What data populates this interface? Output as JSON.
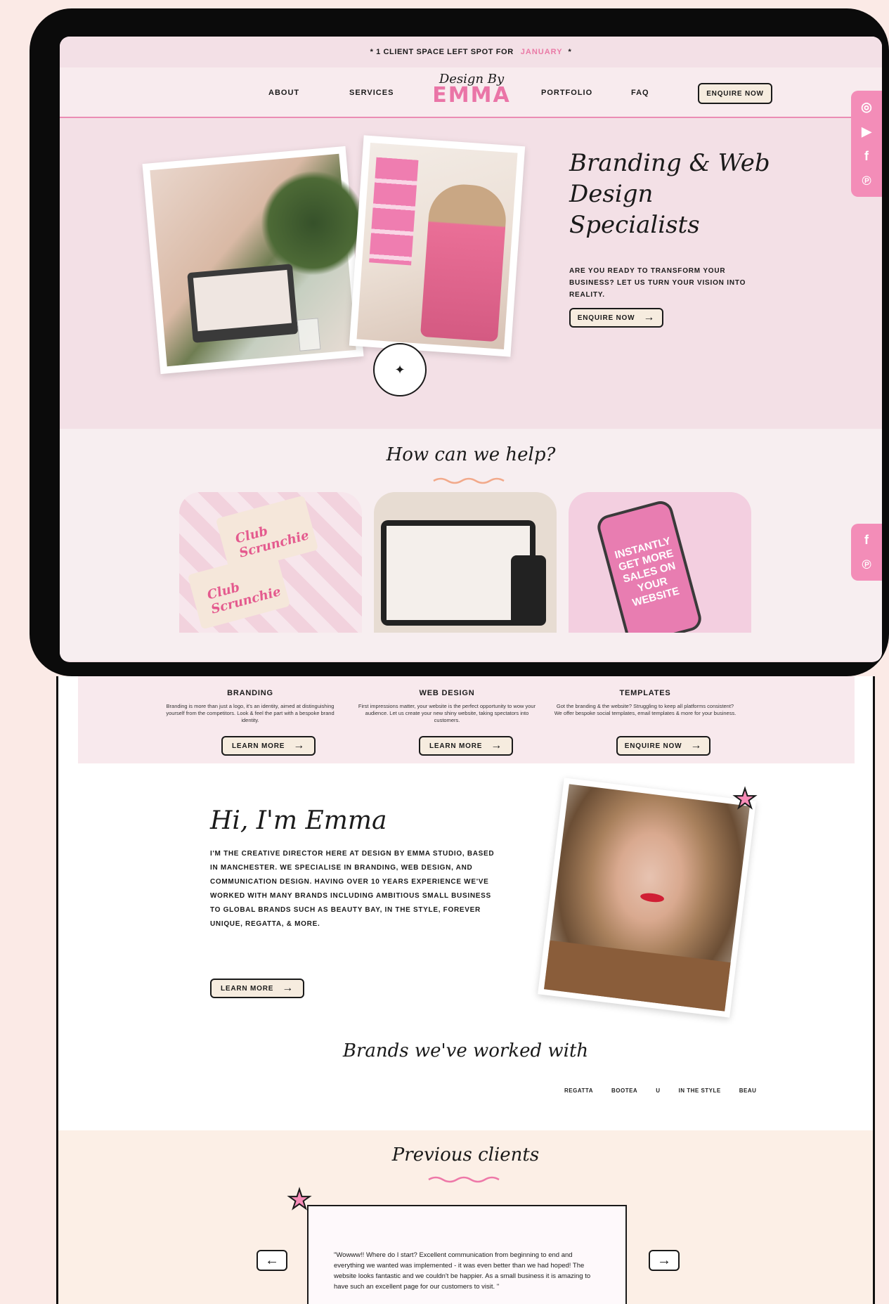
{
  "promo": {
    "text": "* 1 CLIENT SPACE LEFT SPOT FOR",
    "month": "JANUARY",
    "end": "*"
  },
  "nav": {
    "about": "ABOUT",
    "services": "SERVICES",
    "logo_script": "Design By",
    "logo_big": "EMMA",
    "portfolio": "PORTFOLIO",
    "faq": "FAQ",
    "enquire": "ENQUIRE NOW"
  },
  "hero": {
    "title": "Branding & Web Design Specialists",
    "subtitle": "ARE YOU READY TO TRANSFORM YOUR BUSINESS? LET US TURN YOUR VISION INTO REALITY.",
    "cta": "ENQUIRE NOW"
  },
  "social": {
    "instagram": "◎",
    "youtube": "▶",
    "facebook": "f",
    "pinterest": "℗"
  },
  "help": {
    "title": "How can we help?"
  },
  "cards": {
    "brand_logo": "Club Scrunchie",
    "tpl_text": "INSTANTLY GET MORE SALES ON YOUR WEBSITE"
  },
  "services": [
    {
      "title": "BRANDING",
      "text": "Branding is more than just a logo, it's an identity, aimed at distinguishing yourself from the competitors. Look & feel the part with a bespoke brand identity.",
      "button": "LEARN MORE"
    },
    {
      "title": "WEB DESIGN",
      "text": "First impressions matter, your website is the perfect opportunity to wow your audience. Let us create your new shiny website, taking spectators into customers.",
      "button": "LEARN MORE"
    },
    {
      "title": "TEMPLATES",
      "text": "Got the branding & the website? Struggling to keep all platforms consistent? We offer bespoke social templates, email templates & more for your business.",
      "button": "ENQUIRE NOW"
    }
  ],
  "about": {
    "title": "Hi, I'm Emma",
    "body": "I'M THE CREATIVE DIRECTOR HERE AT DESIGN BY EMMA STUDIO, BASED IN MANCHESTER. WE SPECIALISE IN BRANDING, WEB DESIGN, AND COMMUNICATION DESIGN. HAVING OVER 10 YEARS EXPERIENCE WE'VE WORKED WITH MANY BRANDS INCLUDING AMBITIOUS SMALL BUSINESS TO GLOBAL BRANDS SUCH AS BEAUTY BAY, IN THE STYLE, FOREVER UNIQUE, REGATTA, & MORE.",
    "button": "LEARN MORE"
  },
  "brands": {
    "title": "Brands we've worked with",
    "logos": [
      "REGATTA",
      "BOOTEA",
      "U",
      "IN THE STYLE",
      "BEAU"
    ]
  },
  "clients": {
    "title": "Previous clients",
    "quote": "\"Wowww!! Where do I start? Excellent communication from beginning to end and everything we wanted was implemented - it was even better than we had hoped! The website looks fantastic and we couldn't be happier. As a small business it is amazing to have such an excellent page for our customers to visit. \"",
    "prev": "←",
    "next": "→"
  },
  "colors": {
    "accent": "#ea75a7",
    "hero_bg": "#f3e0e6",
    "clients_bg": "#fcefe6"
  }
}
